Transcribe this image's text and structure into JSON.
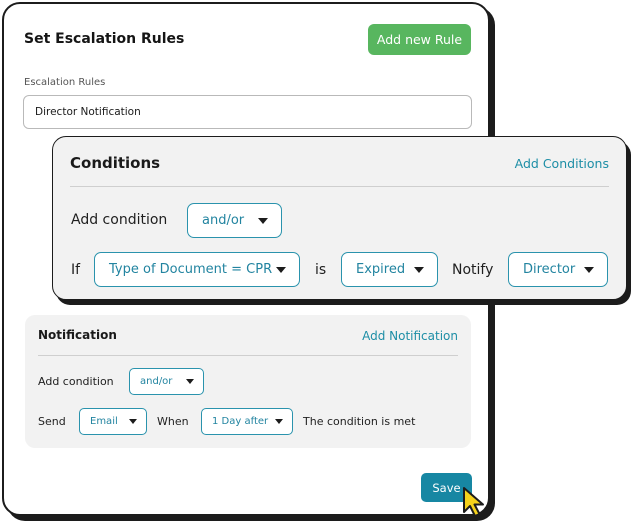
{
  "header": {
    "title": "Set Escalation Rules",
    "add_rule_label": "Add new Rule"
  },
  "rule_field": {
    "label": "Escalation Rules",
    "value": "Director Notification"
  },
  "conditions": {
    "title": "Conditions",
    "add_link": "Add Conditions",
    "add_condition_label": "Add condition",
    "combinator": "and/or",
    "if_label": "If",
    "document_select": "Type of Document = CPR",
    "is_label": "is",
    "status_select": "Expired",
    "notify_label": "Notify",
    "notify_select": "Director"
  },
  "notification": {
    "title": "Notification",
    "add_link": "Add Notification",
    "add_condition_label": "Add condition",
    "combinator": "and/or",
    "send_label": "Send",
    "send_select": "Email",
    "when_label": "When",
    "when_select": "1 Day after",
    "condition_text": "The condition is met"
  },
  "footer": {
    "save_label": "Save"
  },
  "colors": {
    "primary_green": "#58b65f",
    "accent_teal": "#1787a3",
    "link_teal": "#1d8ea6",
    "cursor_yellow": "#f5d21b",
    "panel_gray": "#f2f2f2",
    "border_dark": "#1c1c1c"
  },
  "icons": {
    "dropdown": "caret-down-icon",
    "cursor": "pointer-cursor-icon"
  }
}
